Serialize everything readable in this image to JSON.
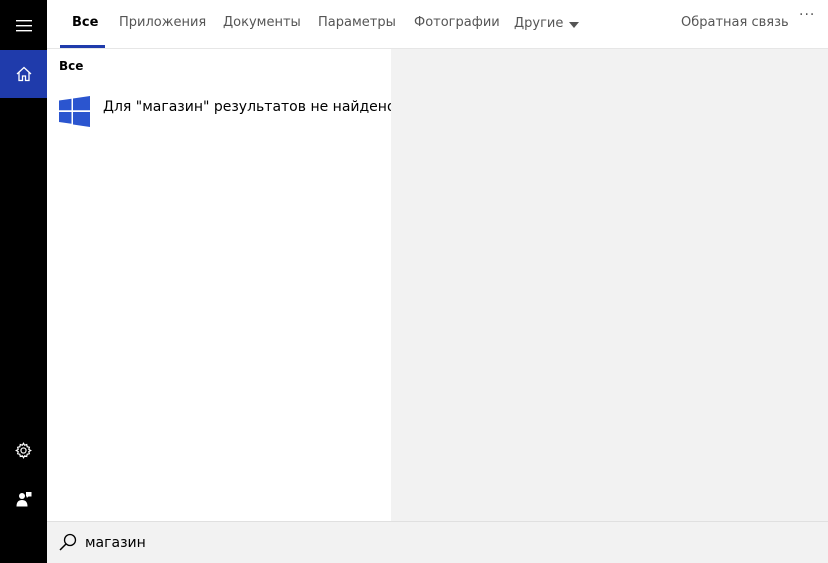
{
  "tabs": {
    "all": "Все",
    "apps": "Приложения",
    "documents": "Документы",
    "settings": "Параметры",
    "photos": "Фотографии",
    "other": "Другие",
    "feedback": "Обратная связь",
    "more": "···"
  },
  "results": {
    "section_title": "Все",
    "no_results_text": "Для \"магазин\" результатов не найдено"
  },
  "search": {
    "value": "магазин"
  },
  "colors": {
    "accent": "#1f3bab",
    "rail": "#000000",
    "preview_bg": "#f2f2f2"
  },
  "icons": [
    "hamburger-menu-icon",
    "home-icon",
    "gear-icon",
    "person-feedback-icon",
    "windows-logo-icon",
    "search-icon"
  ]
}
